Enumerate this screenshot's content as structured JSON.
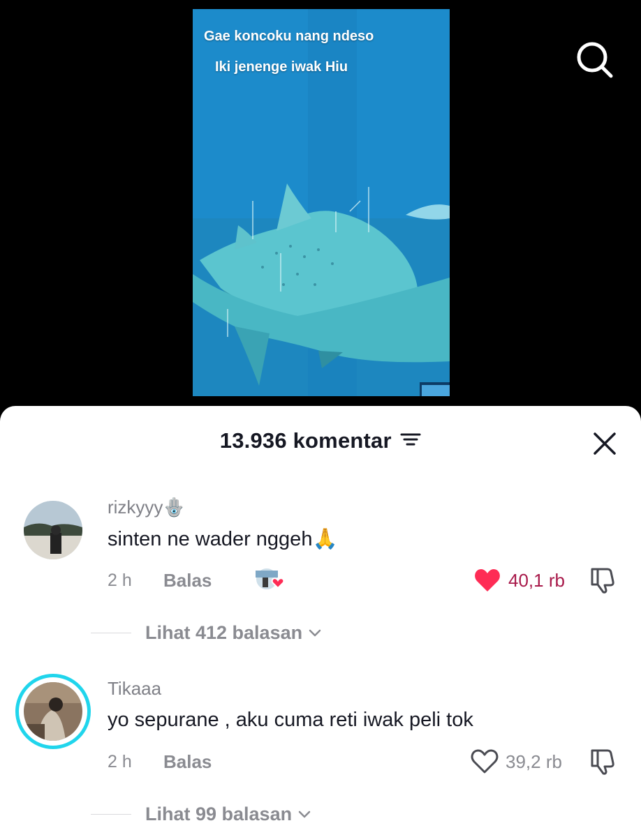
{
  "video": {
    "caption_line1": "Gae koncoku nang ndeso",
    "caption_line2": "Iki jenenge iwak Hiu"
  },
  "header": {
    "search_icon": "search-icon"
  },
  "sheet": {
    "comment_count_label": "13.936 komentar",
    "sort_icon": "sort-icon",
    "close_icon": "close-icon"
  },
  "comments": [
    {
      "username": "rizkyyy🪬",
      "text": "sinten ne wader nggeh🙏",
      "time": "2 h",
      "reply_label": "Balas",
      "likes": "40,1 rb",
      "liked": true,
      "creator_liked": true,
      "view_replies": "Lihat 412 balasan"
    },
    {
      "username": "Tikaaa",
      "text": "yo sepurane , aku cuma reti iwak peli tok",
      "time": "2 h",
      "reply_label": "Balas",
      "likes": "39,2 rb",
      "liked": false,
      "creator_liked": false,
      "view_replies": "Lihat 99 balasan"
    }
  ],
  "colors": {
    "like_red": "#fe2c55",
    "liked_count": "#a8194a",
    "text_dark": "#161823",
    "text_muted": "#8a8b91",
    "story_ring": "#20d5ec"
  }
}
